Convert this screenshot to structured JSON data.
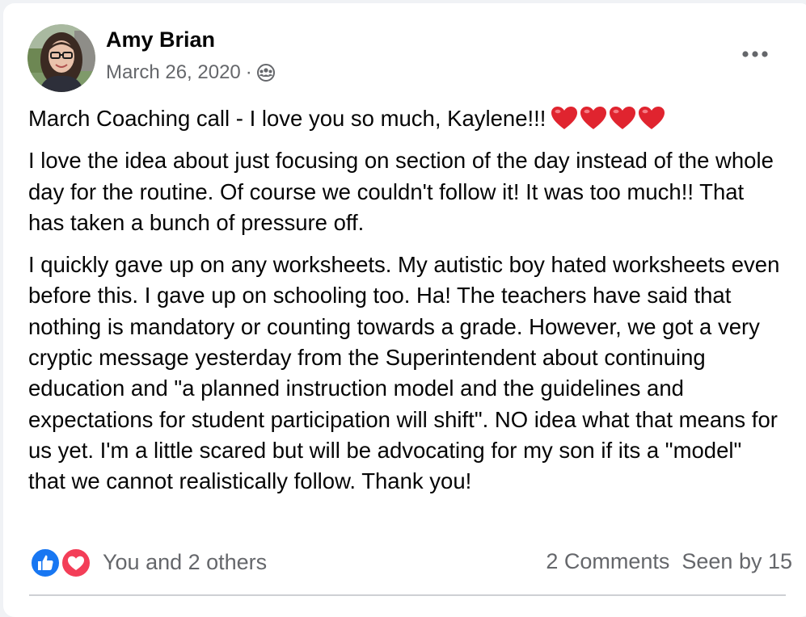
{
  "post": {
    "author": "Amy Brian",
    "date": "March 26, 2020",
    "separator": "·",
    "privacy_icon": "group-icon",
    "more_icon": "more-options-icon",
    "paragraphs": [
      "March Coaching call - I love you so much, Kaylene!!!",
      "I love the idea about just focusing on section of the day instead of the whole day for the routine. Of course we couldn't follow it! It was too much!! That has taken a bunch of pressure off.",
      "I quickly gave up on any worksheets. My autistic boy hated worksheets even before this. I gave up on schooling too. Ha! The teachers have said that nothing is mandatory or counting towards a grade. However, we got a very cryptic message yesterday from the Superintendent about continuing education and \"a planned instruction model and the guidelines and expectations for student participation will shift\". NO idea what that means for us yet. I'm a little scared but will be advocating for my son if its a \"model\" that we cannot realistically follow. Thank you!"
    ],
    "heart_emoji_count": 4
  },
  "footer": {
    "reactions_text": "You and 2 others",
    "comments": "2 Comments",
    "seen": "Seen by 15"
  },
  "colors": {
    "like_blue": "#1877f2",
    "love_red": "#f33e58",
    "secondary_text": "#65676b",
    "heart_red": "#e0242f"
  }
}
